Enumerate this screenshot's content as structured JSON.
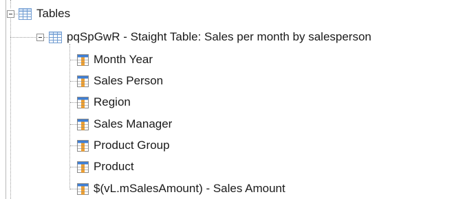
{
  "tree": {
    "root": {
      "label": "Tables",
      "icon": "table-grid-icon",
      "expanded": true
    },
    "table": {
      "label": "pqSpGwR - Staight Table: Sales per month by salesperson",
      "icon": "table-grid-icon",
      "expanded": true
    },
    "fields": [
      {
        "label": "Month Year",
        "icon": "table-column-icon"
      },
      {
        "label": "Sales Person",
        "icon": "table-column-icon"
      },
      {
        "label": "Region",
        "icon": "table-column-icon"
      },
      {
        "label": "Sales Manager",
        "icon": "table-column-icon"
      },
      {
        "label": "Product Group",
        "icon": "table-column-icon"
      },
      {
        "label": "Product",
        "icon": "table-column-icon"
      },
      {
        "label": "$(vL.mSalesAmount) - Sales Amount",
        "icon": "table-column-icon"
      }
    ]
  },
  "colors": {
    "grid_border": "#6f9bd1",
    "grid_header": "#c9dcf2",
    "field_header": "#3f7fd4",
    "field_column": "#f0a030",
    "connector": "#9a9a9a"
  }
}
